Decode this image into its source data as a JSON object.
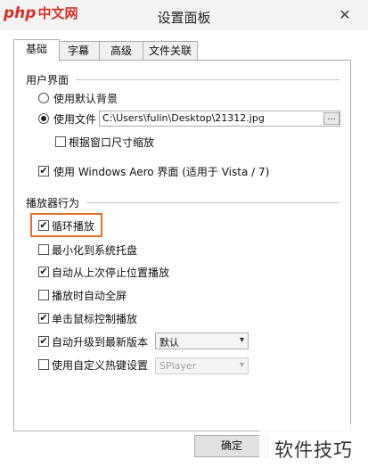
{
  "window": {
    "title": "设置面板",
    "close_glyph": "✕"
  },
  "logo": {
    "brand_latin": "php",
    "brand_cn": "中文网"
  },
  "tabs": [
    {
      "label": "基础",
      "active": true
    },
    {
      "label": "字幕",
      "active": false
    },
    {
      "label": "高级",
      "active": false
    },
    {
      "label": "文件关联",
      "active": false
    }
  ],
  "ui_group": {
    "label": "用户界面",
    "radio_default_bg": {
      "label": "使用默认背景",
      "selected": false
    },
    "radio_use_file": {
      "label": "使用文件",
      "selected": true
    },
    "file_path": "C:\\Users\\fulin\\Desktop\\21312.jpg",
    "browse_label": "...",
    "scale_checkbox": {
      "label": "根据窗口尺寸缩放",
      "checked": false
    },
    "aero_checkbox": {
      "label": "使用 Windows Aero 界面 (适用于 Vista / 7)",
      "checked": true
    }
  },
  "player_group": {
    "label": "播放器行为",
    "options": [
      {
        "label": "循环播放",
        "checked": true
      },
      {
        "label": "最小化到系统托盘",
        "checked": false
      },
      {
        "label": "自动从上次停止位置播放",
        "checked": true
      },
      {
        "label": "播放时自动全屏",
        "checked": false
      },
      {
        "label": "单击鼠标控制播放",
        "checked": true
      },
      {
        "label": "自动升级到最新版本",
        "checked": true
      },
      {
        "label": "使用自定义热键设置",
        "checked": false
      }
    ],
    "upgrade_select": {
      "value": "默认"
    },
    "hotkey_select": {
      "value": "SPlayer",
      "disabled": true
    }
  },
  "footer": {
    "ok_label": "确定"
  },
  "watermark": {
    "text": "软件技巧"
  },
  "colors": {
    "highlight": "#e8722a",
    "logo": "#d9302b"
  },
  "check_glyph": "✔"
}
